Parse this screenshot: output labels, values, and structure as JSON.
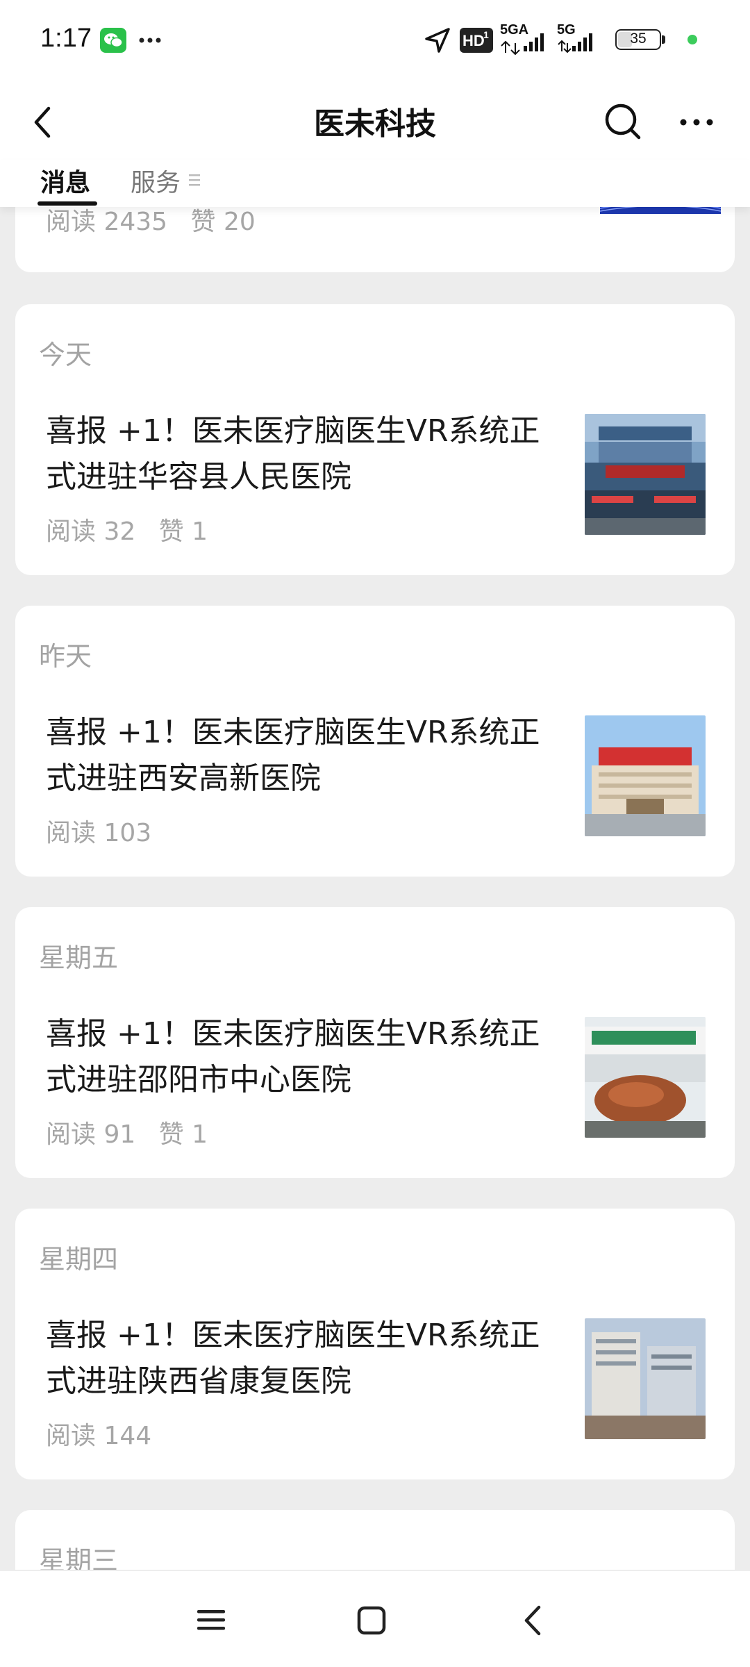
{
  "status_bar": {
    "time": "1:17",
    "icons": [
      "wechat-icon",
      "more-dots-icon",
      "location-arrow-icon",
      "hd-icon",
      "signal-5g-icon",
      "signal-5g-icon",
      "battery-icon",
      "status-dot"
    ],
    "hd_label": "HD",
    "hd_sub": "1",
    "network_1": "5GA",
    "network_2": "5G",
    "battery": "35",
    "dot_color": "#3ccc5c"
  },
  "header": {
    "title": "医未科技",
    "icons": [
      "back-arrow-icon",
      "search-icon",
      "more-dots-icon"
    ]
  },
  "tabs": {
    "messages": "消息",
    "services": "服务",
    "services_icon": "menu-lines-icon"
  },
  "feed": {
    "partial_card": {
      "read": "阅读 2435",
      "like": "赞 20"
    },
    "cards": [
      {
        "date": "今天",
        "title": "喜报 +1！医未医疗脑医生VR系统正式进驻华容县人民医院",
        "read": "阅读 32",
        "like": "赞 1"
      },
      {
        "date": "昨天",
        "title": "喜报 +1！医未医疗脑医生VR系统正式进驻西安高新医院",
        "read": "阅读 103",
        "like": ""
      },
      {
        "date": "星期五",
        "title": "喜报 +1！医未医疗脑医生VR系统正式进驻邵阳市中心医院",
        "read": "阅读 91",
        "like": "赞 1"
      },
      {
        "date": "星期四",
        "title": "喜报 +1！医未医疗脑医生VR系统正式进驻陕西省康复医院",
        "read": "阅读 144",
        "like": ""
      },
      {
        "date": "星期三"
      }
    ]
  },
  "nav_bar": {
    "icons": [
      "menu-icon",
      "home-square-icon",
      "back-chevron-icon"
    ]
  },
  "colors": {
    "background": "#ededed",
    "card": "#ffffff",
    "muted_text": "#a6a6a6",
    "wechat_green": "#2ac14a"
  }
}
